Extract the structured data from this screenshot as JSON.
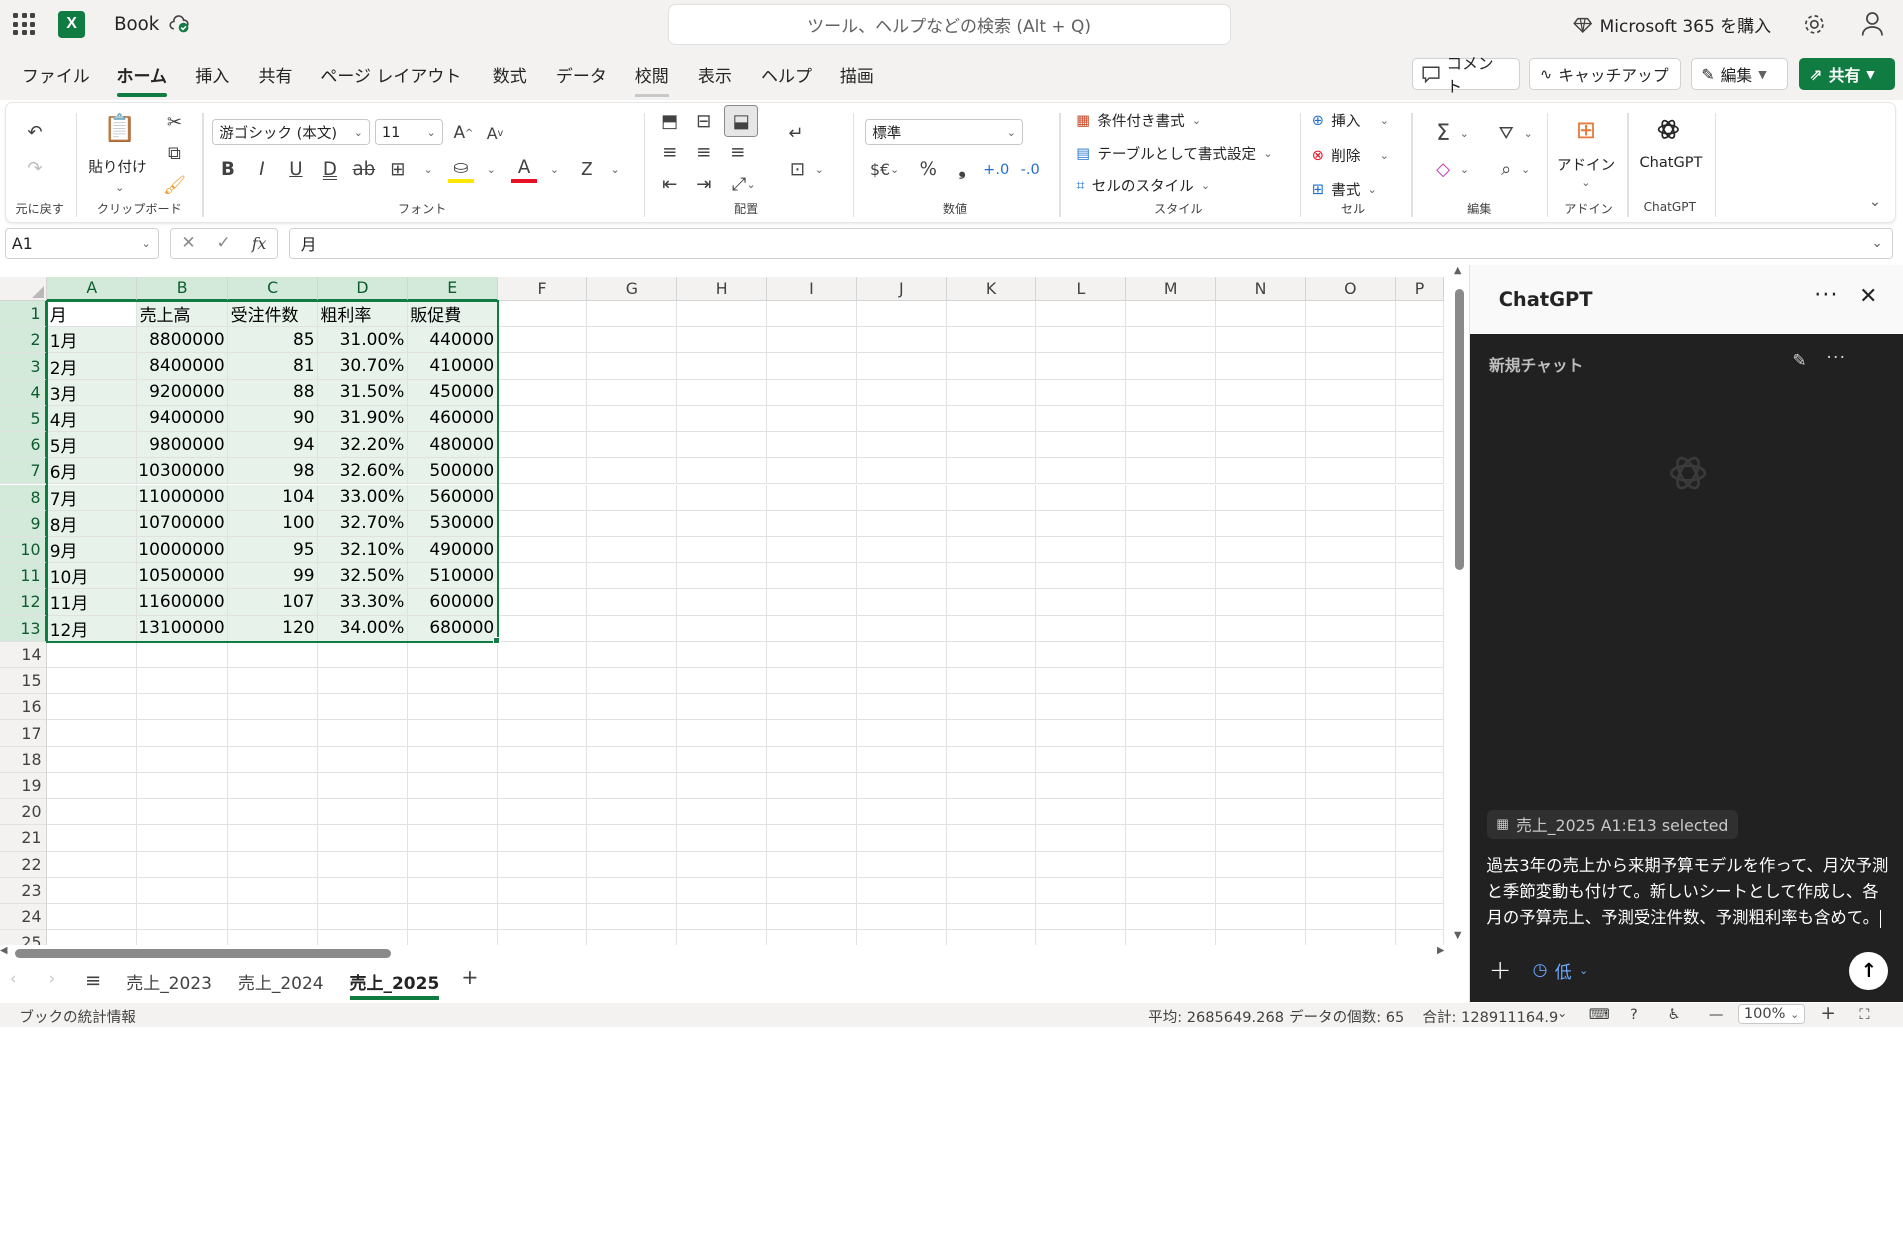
{
  "app": {
    "doc_title": "Book",
    "search_placeholder": "ツール、ヘルプなどの検索 (Alt + Q)",
    "buy_label": "Microsoft 365 を購入"
  },
  "menu": {
    "tabs": [
      "ファイル",
      "ホーム",
      "挿入",
      "共有",
      "ページ レイアウト",
      "数式",
      "データ",
      "校閲",
      "表示",
      "ヘルプ",
      "描画"
    ],
    "active": "ホーム",
    "comment": "コメント",
    "catchup": "キャッチアップ",
    "edit": "編集",
    "share": "共有"
  },
  "ribbon": {
    "undo_group": "元に戻す",
    "paste": "貼り付け",
    "clipboard_group": "クリップボード",
    "font_name": "游ゴシック (本文)",
    "font_size": "11",
    "font_group": "フォント",
    "align_group": "配置",
    "number_format": "標準",
    "number_group": "数値",
    "cond_format": "条件付き書式",
    "table_format": "テーブルとして書式設定",
    "cell_style": "セルのスタイル",
    "style_group": "スタイル",
    "insert": "挿入",
    "delete": "削除",
    "format": "書式",
    "cells_group": "セル",
    "edit_group": "編集",
    "addin": "アドイン",
    "addin_group": "アドイン",
    "chatgpt": "ChatGPT",
    "chatgpt_group": "ChatGPT"
  },
  "formula_bar": {
    "name_box": "A1",
    "content": "月"
  },
  "sheet": {
    "columns": [
      "A",
      "B",
      "C",
      "D",
      "E",
      "F",
      "G",
      "H",
      "I",
      "J",
      "K",
      "L",
      "M",
      "N",
      "O",
      "P"
    ],
    "rows": [
      [
        "月",
        "売上高",
        "受注件数",
        "粗利率",
        "販促費"
      ],
      [
        "1月",
        "8800000",
        "85",
        "31.00%",
        "440000"
      ],
      [
        "2月",
        "8400000",
        "81",
        "30.70%",
        "410000"
      ],
      [
        "3月",
        "9200000",
        "88",
        "31.50%",
        "450000"
      ],
      [
        "4月",
        "9400000",
        "90",
        "31.90%",
        "460000"
      ],
      [
        "5月",
        "9800000",
        "94",
        "32.20%",
        "480000"
      ],
      [
        "6月",
        "10300000",
        "98",
        "32.60%",
        "500000"
      ],
      [
        "7月",
        "11000000",
        "104",
        "33.00%",
        "560000"
      ],
      [
        "8月",
        "10700000",
        "100",
        "32.70%",
        "530000"
      ],
      [
        "9月",
        "10000000",
        "95",
        "32.10%",
        "490000"
      ],
      [
        "10月",
        "10500000",
        "99",
        "32.50%",
        "510000"
      ],
      [
        "11月",
        "11600000",
        "107",
        "33.30%",
        "600000"
      ],
      [
        "12月",
        "13100000",
        "120",
        "34.00%",
        "680000"
      ]
    ],
    "row_numbers": [
      "1",
      "2",
      "3",
      "4",
      "5",
      "6",
      "7",
      "8",
      "9",
      "10",
      "11",
      "12",
      "13",
      "14",
      "15",
      "16",
      "17",
      "18",
      "19",
      "20",
      "21",
      "22",
      "23",
      "24",
      "25"
    ]
  },
  "sheet_tabs": {
    "tabs": [
      "売上_2023",
      "売上_2024",
      "売上_2025"
    ],
    "active": "売上_2025"
  },
  "status": {
    "info": "ブックの統計情報",
    "average": "平均: 2685649.268",
    "count": "データの個数: 65",
    "sum": "合計: 128911164.9",
    "zoom": "100%"
  },
  "chatgpt_panel": {
    "title": "ChatGPT",
    "new_chat": "新規チャット",
    "selection_chip": "売上_2025 A1:E13 selected",
    "prompt": "過去3年の売上から来期予算モデルを作って、月次予測と季節変動も付けて。新しいシートとして作成し、各月の予算売上、予測受注件数、予測粗利率も含めて。",
    "reasoning_level": "低"
  },
  "colors": {
    "accent": "#107c41",
    "panel_dark": "#212121"
  }
}
